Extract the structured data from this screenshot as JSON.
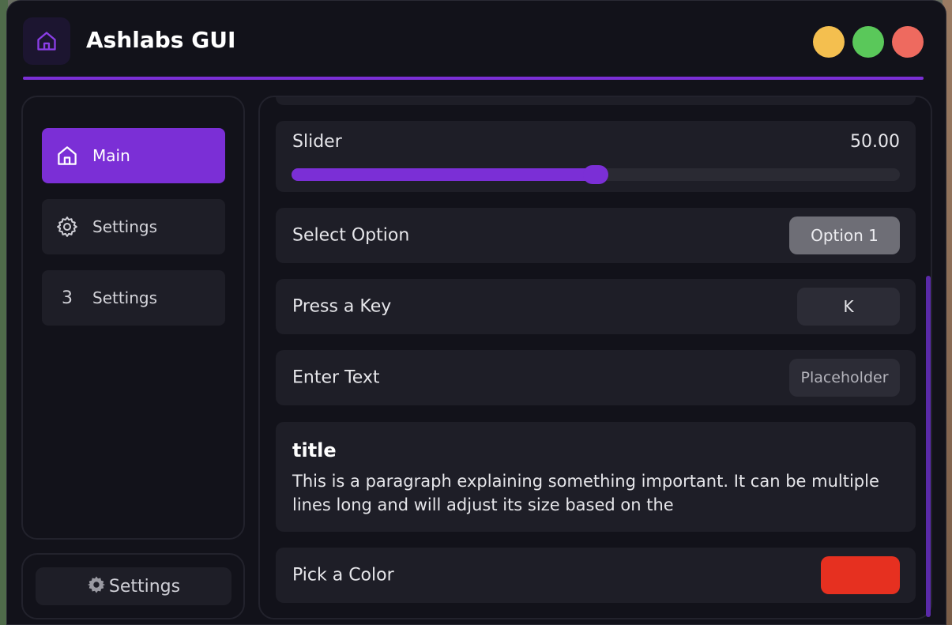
{
  "app": {
    "title": "Ashlabs GUI",
    "icon": "home-icon"
  },
  "window_controls": {
    "minimize_color": "#f4bf4f",
    "maximize_color": "#5ac85a",
    "close_color": "#ee6a5f"
  },
  "colors": {
    "accent": "#7b2fd6",
    "background": "#12121a",
    "card": "#1e1e27",
    "color_pick": "#e63020"
  },
  "sidebar": {
    "items": [
      {
        "label": "Main",
        "icon": "home-icon",
        "active": true
      },
      {
        "label": "Settings",
        "icon": "gear-icon",
        "active": false
      },
      {
        "label": "Settings",
        "icon": "3",
        "active": false
      }
    ]
  },
  "footer": {
    "settings_label": "Settings",
    "icon": "gear-icon"
  },
  "controls": {
    "slider": {
      "label": "Slider",
      "value_text": "50.00",
      "fraction": 0.5
    },
    "select": {
      "label": "Select Option",
      "value": "Option 1"
    },
    "keybind": {
      "label": "Press a Key",
      "value": "K"
    },
    "text_input": {
      "label": "Enter Text",
      "placeholder": "Placeholder"
    },
    "paragraph": {
      "title": "title",
      "text": "This is a paragraph explaining something important. It can be multiple lines long and will adjust its size based on the"
    },
    "color": {
      "label": "Pick a Color",
      "value": "#e63020"
    }
  }
}
